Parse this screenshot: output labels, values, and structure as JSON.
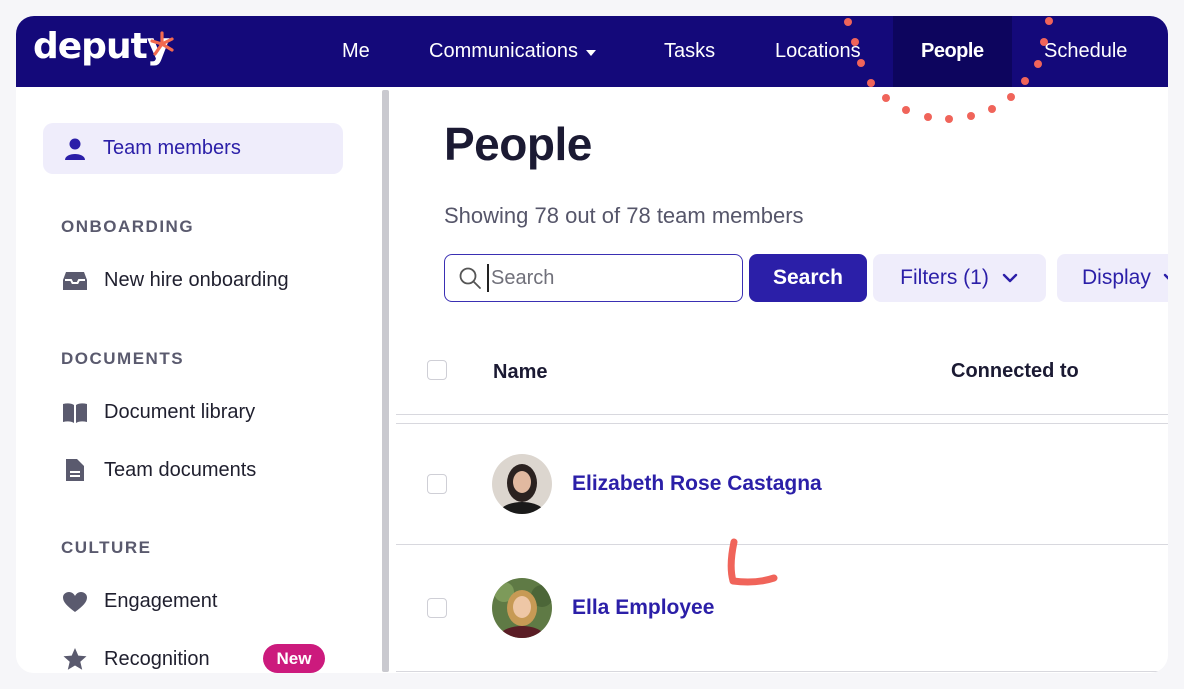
{
  "nav": {
    "logo_text": "deputy",
    "items": [
      {
        "label": "Me"
      },
      {
        "label": "Communications"
      },
      {
        "label": "Tasks"
      },
      {
        "label": "Locations"
      },
      {
        "label": "People"
      },
      {
        "label": "Schedule"
      }
    ],
    "active": "People"
  },
  "sidebar": {
    "active_item": "Team members",
    "sections": [
      {
        "heading": "ONBOARDING",
        "items": [
          {
            "label": "New hire onboarding",
            "icon": "inbox-icon"
          }
        ]
      },
      {
        "heading": "DOCUMENTS",
        "items": [
          {
            "label": "Document library",
            "icon": "book-icon"
          },
          {
            "label": "Team documents",
            "icon": "file-icon"
          }
        ]
      },
      {
        "heading": "CULTURE",
        "items": [
          {
            "label": "Engagement",
            "icon": "heart-icon"
          },
          {
            "label": "Recognition",
            "icon": "star-icon",
            "badge": "New"
          }
        ]
      }
    ]
  },
  "main": {
    "title": "People",
    "showing": "Showing 78 out of 78 team members",
    "search_placeholder": "Search",
    "search_button": "Search",
    "filters_button": "Filters (1)",
    "display_button": "Display",
    "columns": [
      "Name",
      "Connected to"
    ],
    "rows": [
      {
        "name": "Elizabeth Rose Castagna"
      },
      {
        "name": "Ella Employee"
      }
    ]
  },
  "colors": {
    "nav_bg": "#14097a",
    "accent": "#2b1fa8",
    "badge": "#cc1a7d",
    "annotation": "#f0645a"
  }
}
